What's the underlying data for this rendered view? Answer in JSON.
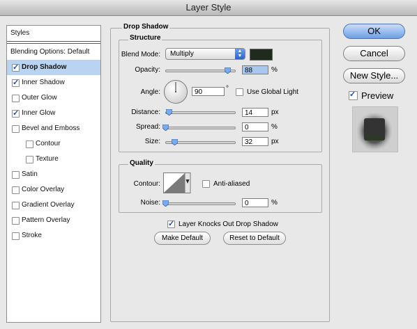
{
  "window": {
    "title": "Layer Style"
  },
  "sidebar": {
    "header": "Styles",
    "items": [
      {
        "label": "Blending Options: Default",
        "checkbox": false,
        "checked": false,
        "selected": false
      },
      {
        "label": "Drop Shadow",
        "checkbox": true,
        "checked": true,
        "selected": true
      },
      {
        "label": "Inner Shadow",
        "checkbox": true,
        "checked": true,
        "selected": false
      },
      {
        "label": "Outer Glow",
        "checkbox": true,
        "checked": false,
        "selected": false
      },
      {
        "label": "Inner Glow",
        "checkbox": true,
        "checked": true,
        "selected": false
      },
      {
        "label": "Bevel and Emboss",
        "checkbox": true,
        "checked": false,
        "selected": false
      },
      {
        "label": "Contour",
        "checkbox": true,
        "checked": false,
        "selected": false
      },
      {
        "label": "Texture",
        "checkbox": true,
        "checked": false,
        "selected": false
      },
      {
        "label": "Satin",
        "checkbox": true,
        "checked": false,
        "selected": false
      },
      {
        "label": "Color Overlay",
        "checkbox": true,
        "checked": false,
        "selected": false
      },
      {
        "label": "Gradient Overlay",
        "checkbox": true,
        "checked": false,
        "selected": false
      },
      {
        "label": "Pattern Overlay",
        "checkbox": true,
        "checked": false,
        "selected": false
      },
      {
        "label": "Stroke",
        "checkbox": true,
        "checked": false,
        "selected": false
      }
    ]
  },
  "panel": {
    "title": "Drop Shadow",
    "structure": {
      "title": "Structure",
      "blend_mode_label": "Blend Mode:",
      "blend_mode_value": "Multiply",
      "shadow_color": "#1f2b1c",
      "opacity_label": "Opacity:",
      "opacity_value": "88",
      "opacity_fraction": 0.88,
      "opacity_unit": "%",
      "angle_label": "Angle:",
      "angle_value": "90",
      "angle_unit": "°",
      "use_global_light_label": "Use Global Light",
      "use_global_light": false,
      "distance_label": "Distance:",
      "distance_value": "14",
      "distance_fraction": 0.05,
      "distance_unit": "px",
      "spread_label": "Spread:",
      "spread_value": "0",
      "spread_fraction": 0.0,
      "spread_unit": "%",
      "size_label": "Size:",
      "size_value": "32",
      "size_fraction": 0.13,
      "size_unit": "px"
    },
    "quality": {
      "title": "Quality",
      "contour_label": "Contour:",
      "anti_aliased_label": "Anti-aliased",
      "anti_aliased": false,
      "noise_label": "Noise:",
      "noise_value": "0",
      "noise_fraction": 0.0,
      "noise_unit": "%"
    },
    "knockout_label": "Layer Knocks Out Drop Shadow",
    "knockout_checked": true,
    "make_default_label": "Make Default",
    "reset_default_label": "Reset to Default"
  },
  "buttons": {
    "ok": "OK",
    "cancel": "Cancel",
    "new_style": "New Style...",
    "preview_label": "Preview",
    "preview_checked": true
  },
  "accent_color": "#6e9fe3"
}
